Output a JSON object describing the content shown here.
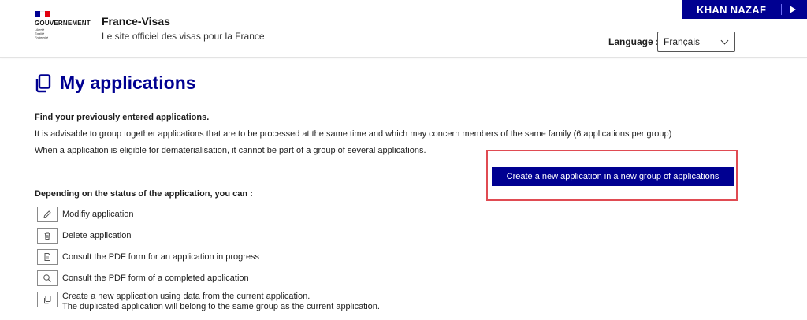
{
  "header": {
    "gov_title": "GOUVERNEMENT",
    "motto": [
      "Liberté",
      "Égalité",
      "Fraternité"
    ],
    "site_name": "France-Visas",
    "site_desc": "Le site officiel des visas pour la France",
    "user_name": "KHAN NAZAF",
    "language_label": "Language :",
    "language_value": "Français"
  },
  "main": {
    "title": "My applications",
    "intro_bold": "Find your previously entered applications.",
    "intro_line1": "It is advisable to group together applications that are to be processed at the same time and which may concern members of the same family (6 applications per group)",
    "intro_line2": "When a application is eligible for dematerialisation, it cannot be part of a group of several applications.",
    "create_button": "Create a new application in a new group of applications",
    "status_heading": "Depending on the status of the application, you can :",
    "actions": [
      {
        "icon": "pencil-icon",
        "label": "Modifiy application"
      },
      {
        "icon": "trash-icon",
        "label": "Delete application"
      },
      {
        "icon": "pdf-document-icon",
        "label": "Consult the PDF form for an application in progress"
      },
      {
        "icon": "magnifier-icon",
        "label": "Consult the PDF form of a completed application"
      },
      {
        "icon": "duplicate-icon",
        "label": "Create a new application using data from the current application.",
        "label2": "The duplicated application will belong to the same group as the current application."
      }
    ]
  },
  "colors": {
    "brand_blue": "#000091",
    "highlight_red": "#e04b52",
    "flag_blue": "#000091",
    "flag_white": "#ffffff",
    "flag_red": "#e1000f"
  }
}
